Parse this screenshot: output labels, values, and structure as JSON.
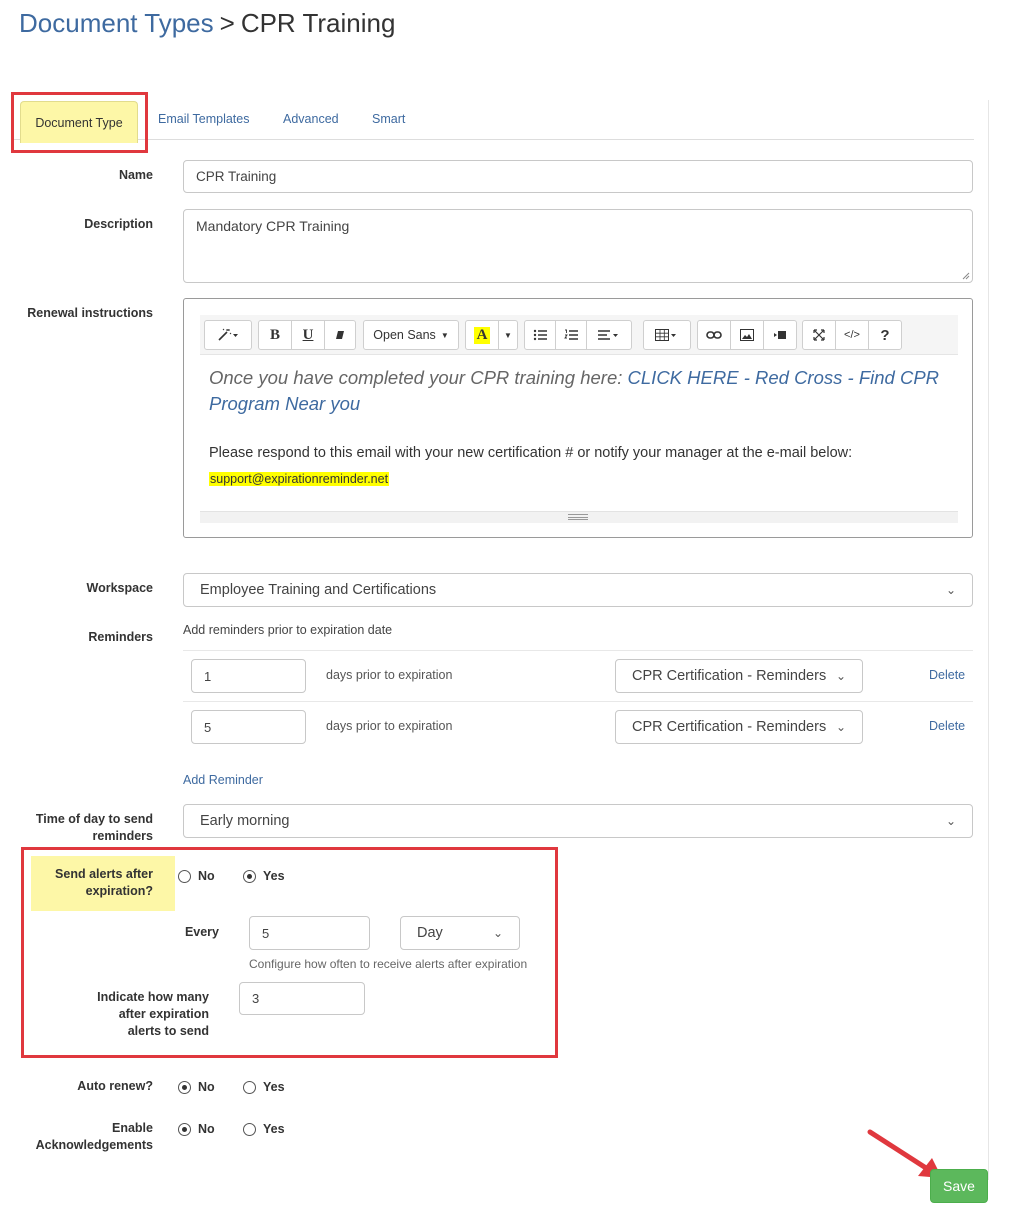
{
  "breadcrumb": {
    "parent": "Document Types",
    "separator": ">",
    "current": "CPR Training"
  },
  "tabs": [
    {
      "label": "Document Type",
      "active": true
    },
    {
      "label": "Email Templates",
      "active": false
    },
    {
      "label": "Advanced",
      "active": false
    },
    {
      "label": "Smart",
      "active": false
    }
  ],
  "form": {
    "name": {
      "label": "Name",
      "value": "CPR Training"
    },
    "description": {
      "label": "Description",
      "value": "Mandatory CPR Training"
    },
    "renewal": {
      "label": "Renewal instructions",
      "toolbar": {
        "font_name": "Open Sans",
        "icons": [
          "magic-wand-icon",
          "bold-icon",
          "underline-icon",
          "eraser-icon",
          "font-color-icon",
          "unordered-list-icon",
          "ordered-list-icon",
          "align-icon",
          "table-icon",
          "link-icon",
          "image-icon",
          "video-icon",
          "fullscreen-icon",
          "code-view-icon",
          "help-icon"
        ],
        "bold": "B",
        "underline": "U",
        "font_color": "A",
        "help": "?",
        "code": "</>"
      },
      "content": {
        "italic_prefix": "Once you have completed your CPR training here: ",
        "italic_link": "CLICK HERE - Red Cross - Find CPR Program Near you",
        "paragraph": "Please respond to this email with your new certification # or notify your manager at the e-mail below:",
        "highlighted_email": "support@expirationreminder.net"
      }
    },
    "workspace": {
      "label": "Workspace",
      "value": "Employee Training and Certifications"
    },
    "reminders": {
      "label": "Reminders",
      "intro": "Add reminders prior to expiration date",
      "rows": [
        {
          "days": "1",
          "suffix": "days prior to expiration",
          "template": "CPR Certification - Reminders",
          "delete_label": "Delete"
        },
        {
          "days": "5",
          "suffix": "days prior to expiration",
          "template": "CPR Certification - Reminders",
          "delete_label": "Delete"
        }
      ],
      "add_label": "Add Reminder"
    },
    "time_of_day": {
      "label_line1": "Time of day to send",
      "label_line2": "reminders",
      "value": "Early morning"
    },
    "alerts": {
      "label_line1": "Send alerts after",
      "label_line2": "expiration?",
      "options": [
        {
          "label": "No",
          "selected": false
        },
        {
          "label": "Yes",
          "selected": true
        }
      ],
      "every_label": "Every",
      "every_value": "5",
      "every_unit": "Day",
      "every_hint": "Configure how often to receive alerts after expiration",
      "count_label_line1": "Indicate how many",
      "count_label_line2": "after expiration",
      "count_label_line3": "alerts to send",
      "count_value": "3"
    },
    "auto_renew": {
      "label": "Auto renew?",
      "options": [
        {
          "label": "No",
          "selected": true
        },
        {
          "label": "Yes",
          "selected": false
        }
      ]
    },
    "acknowledgements": {
      "label_line1": "Enable",
      "label_line2": "Acknowledgements",
      "options": [
        {
          "label": "No",
          "selected": true
        },
        {
          "label": "Yes",
          "selected": false
        }
      ]
    }
  },
  "save_label": "Save",
  "colors": {
    "link": "#3e6aa0",
    "highlight_yellow": "#fdf7a7",
    "annotation_red": "#e0383e",
    "save_green": "#5cb85c"
  }
}
